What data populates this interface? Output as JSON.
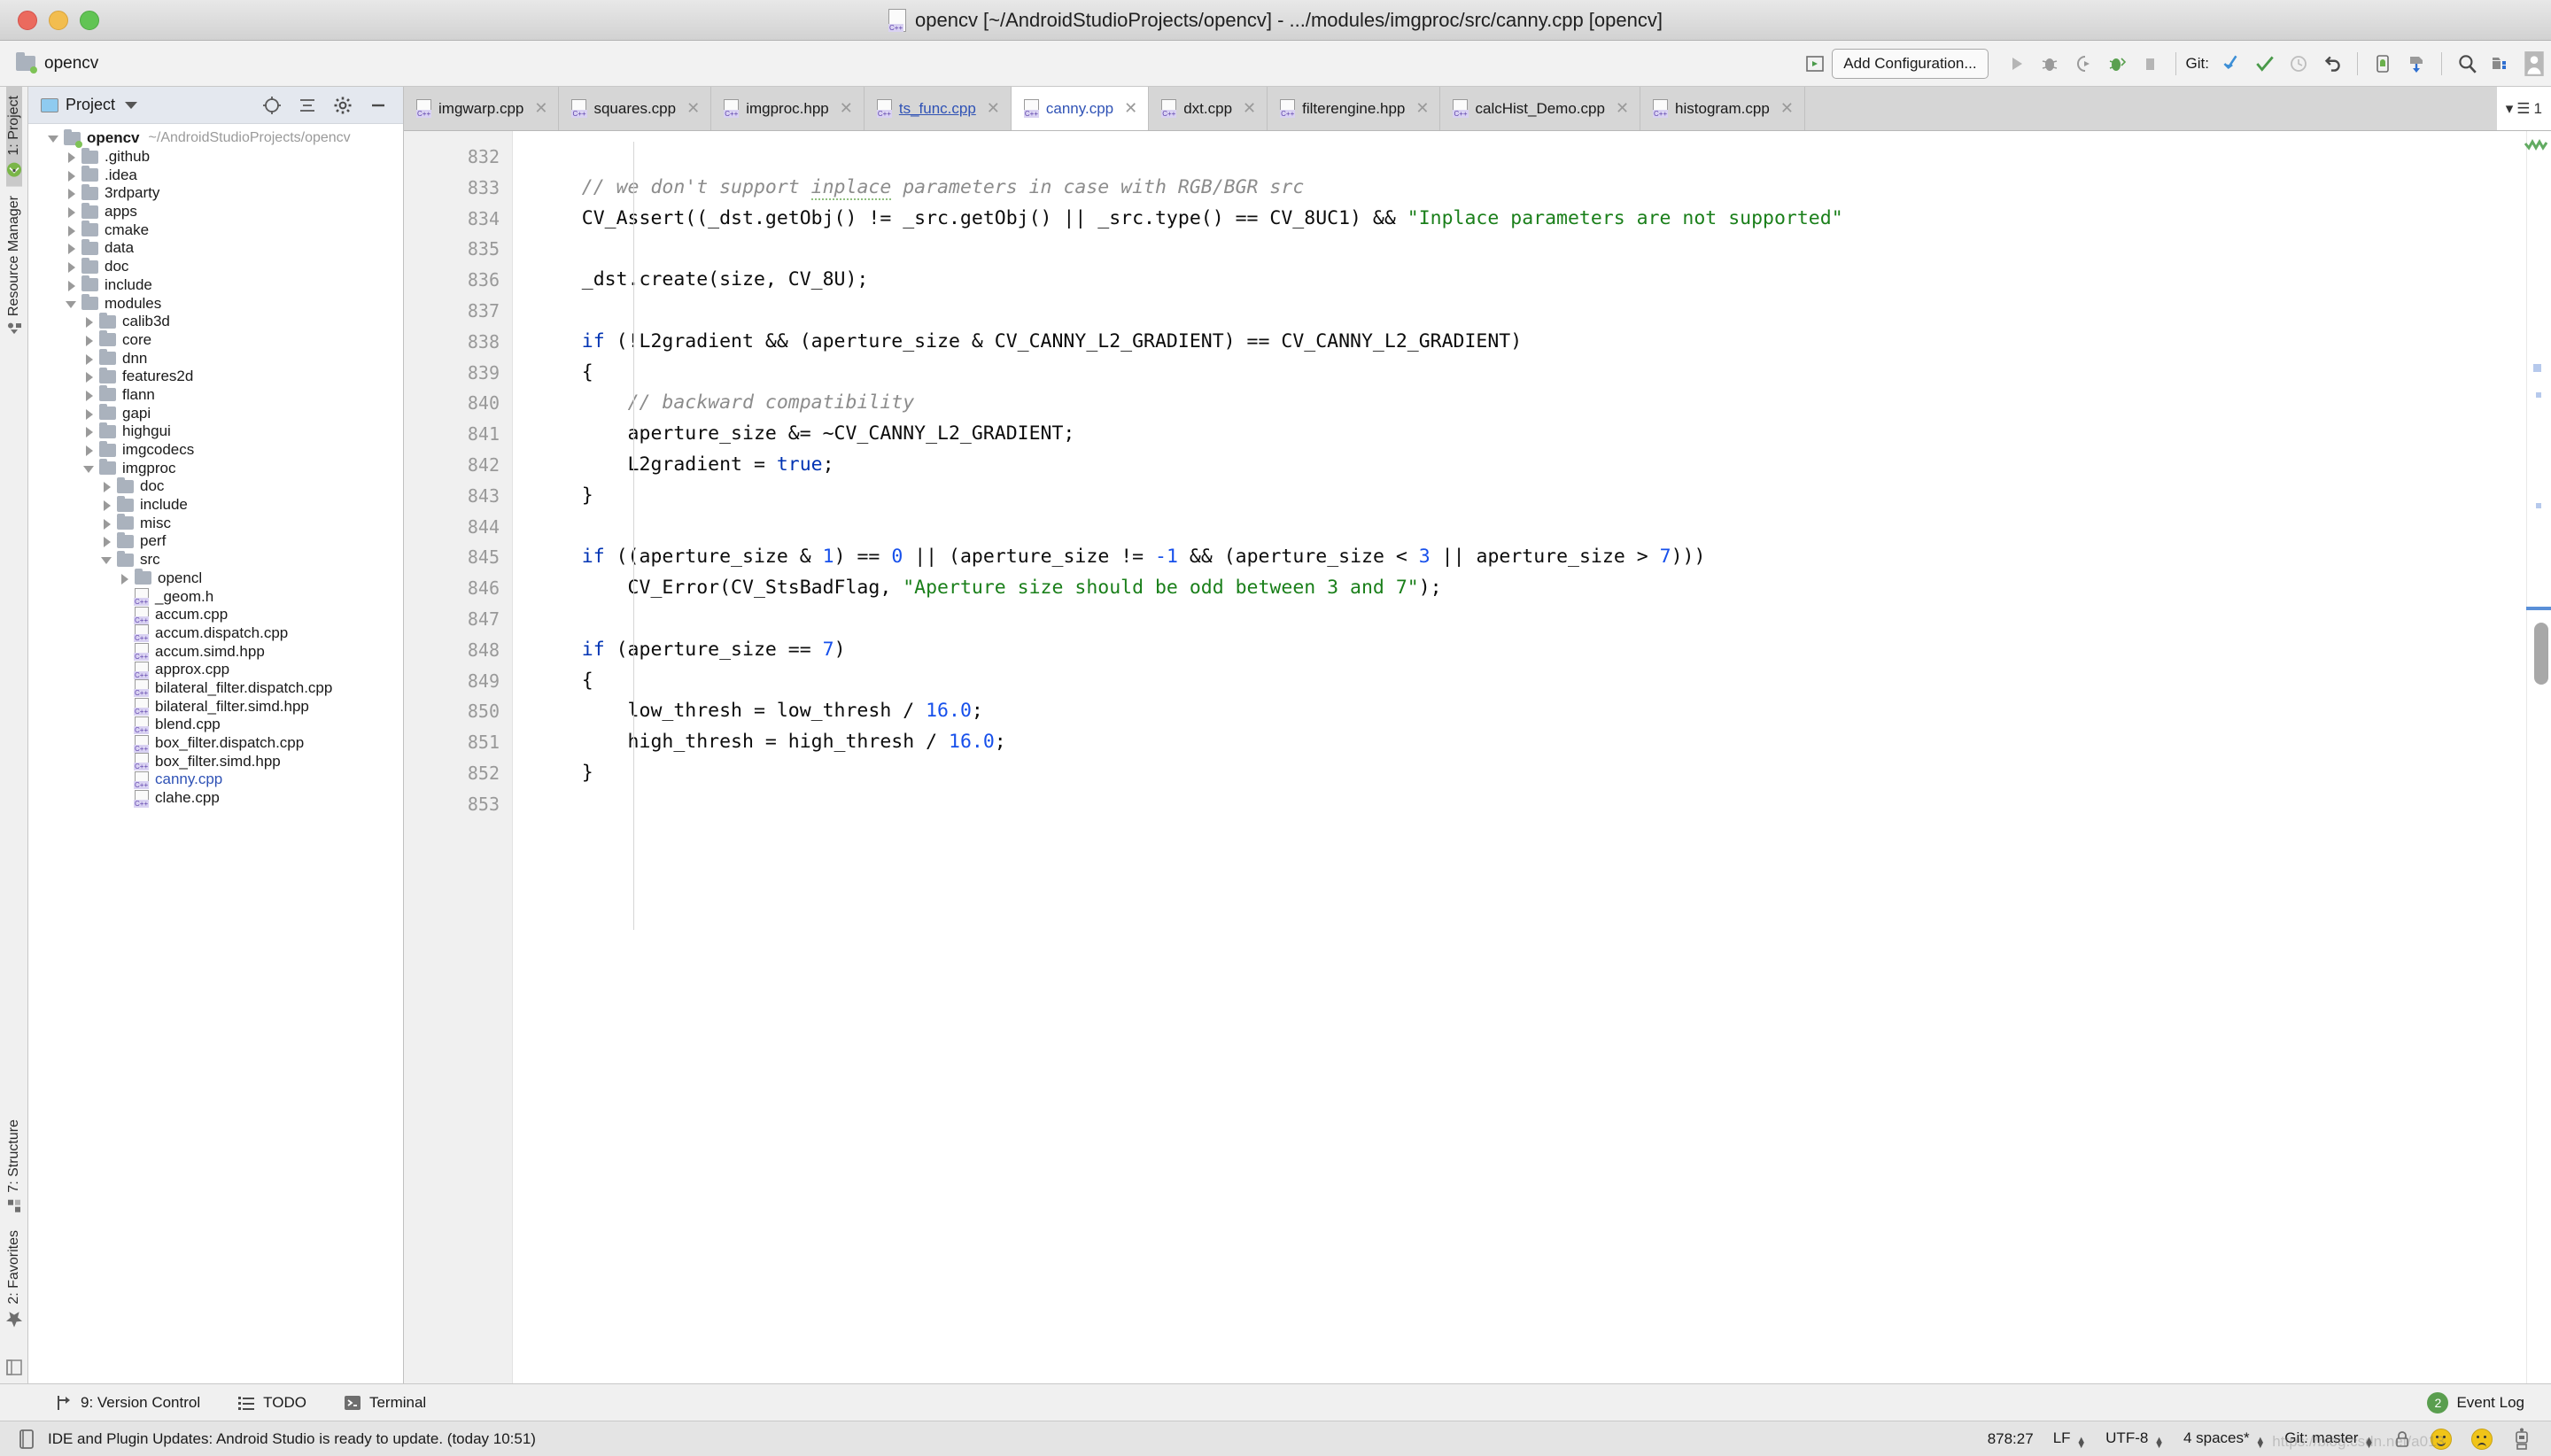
{
  "window": {
    "title": "opencv [~/AndroidStudioProjects/opencv] - .../modules/imgproc/src/canny.cpp [opencv]",
    "file_icon": "cpp-file-icon"
  },
  "toolbar": {
    "project_label": "opencv",
    "add_configuration": "Add Configuration...",
    "git_label": "Git:",
    "icons": [
      "project-structure-icon",
      "run-icon",
      "debug-icon",
      "coverage-icon",
      "profile-icon",
      "stop-icon",
      "update-project-icon",
      "commit-icon",
      "history-icon",
      "revert-icon",
      "avd-manager-icon",
      "sdk-manager-icon",
      "search-everywhere-icon",
      "project-structure-dialog-icon",
      "account-icon"
    ]
  },
  "left_strip": {
    "top": [
      {
        "label": "1: Project",
        "icon": "android-studio-icon",
        "active": true
      },
      {
        "label": "Resource Manager",
        "icon": "shapes-icon",
        "active": false
      }
    ],
    "bottom": [
      {
        "label": "7: Structure",
        "icon": "structure-icon",
        "active": false
      },
      {
        "label": "2: Favorites",
        "icon": "star-icon",
        "active": false
      }
    ]
  },
  "project_panel": {
    "header": {
      "title": "Project",
      "view_icon": "project-view-icon",
      "chevron": "chevron-down-icon",
      "actions": [
        "locate-icon",
        "collapse-all-icon",
        "settings-icon",
        "hide-icon"
      ]
    },
    "tree": [
      {
        "indent": 0,
        "arrow": "open",
        "icon": "folder-modified",
        "name": "opencv",
        "bold": true,
        "path": "~/AndroidStudioProjects/opencv"
      },
      {
        "indent": 1,
        "arrow": "closed",
        "icon": "folder",
        "name": ".github"
      },
      {
        "indent": 1,
        "arrow": "closed",
        "icon": "folder",
        "name": ".idea"
      },
      {
        "indent": 1,
        "arrow": "closed",
        "icon": "folder",
        "name": "3rdparty"
      },
      {
        "indent": 1,
        "arrow": "closed",
        "icon": "folder",
        "name": "apps"
      },
      {
        "indent": 1,
        "arrow": "closed",
        "icon": "folder",
        "name": "cmake"
      },
      {
        "indent": 1,
        "arrow": "closed",
        "icon": "folder",
        "name": "data"
      },
      {
        "indent": 1,
        "arrow": "closed",
        "icon": "folder",
        "name": "doc"
      },
      {
        "indent": 1,
        "arrow": "closed",
        "icon": "folder",
        "name": "include"
      },
      {
        "indent": 1,
        "arrow": "open",
        "icon": "folder",
        "name": "modules"
      },
      {
        "indent": 2,
        "arrow": "closed",
        "icon": "folder",
        "name": "calib3d"
      },
      {
        "indent": 2,
        "arrow": "closed",
        "icon": "folder",
        "name": "core"
      },
      {
        "indent": 2,
        "arrow": "closed",
        "icon": "folder",
        "name": "dnn"
      },
      {
        "indent": 2,
        "arrow": "closed",
        "icon": "folder",
        "name": "features2d"
      },
      {
        "indent": 2,
        "arrow": "closed",
        "icon": "folder",
        "name": "flann"
      },
      {
        "indent": 2,
        "arrow": "closed",
        "icon": "folder",
        "name": "gapi"
      },
      {
        "indent": 2,
        "arrow": "closed",
        "icon": "folder",
        "name": "highgui"
      },
      {
        "indent": 2,
        "arrow": "closed",
        "icon": "folder",
        "name": "imgcodecs"
      },
      {
        "indent": 2,
        "arrow": "open",
        "icon": "folder",
        "name": "imgproc"
      },
      {
        "indent": 3,
        "arrow": "closed",
        "icon": "folder",
        "name": "doc"
      },
      {
        "indent": 3,
        "arrow": "closed",
        "icon": "folder",
        "name": "include"
      },
      {
        "indent": 3,
        "arrow": "closed",
        "icon": "folder",
        "name": "misc"
      },
      {
        "indent": 3,
        "arrow": "closed",
        "icon": "folder",
        "name": "perf"
      },
      {
        "indent": 3,
        "arrow": "open",
        "icon": "folder",
        "name": "src"
      },
      {
        "indent": 4,
        "arrow": "closed",
        "icon": "folder",
        "name": "opencl"
      },
      {
        "indent": 4,
        "arrow": "none",
        "icon": "cpp",
        "name": "_geom.h"
      },
      {
        "indent": 4,
        "arrow": "none",
        "icon": "cpp",
        "name": "accum.cpp"
      },
      {
        "indent": 4,
        "arrow": "none",
        "icon": "cpp",
        "name": "accum.dispatch.cpp"
      },
      {
        "indent": 4,
        "arrow": "none",
        "icon": "cpp",
        "name": "accum.simd.hpp"
      },
      {
        "indent": 4,
        "arrow": "none",
        "icon": "cpp",
        "name": "approx.cpp"
      },
      {
        "indent": 4,
        "arrow": "none",
        "icon": "cpp",
        "name": "bilateral_filter.dispatch.cpp"
      },
      {
        "indent": 4,
        "arrow": "none",
        "icon": "cpp",
        "name": "bilateral_filter.simd.hpp"
      },
      {
        "indent": 4,
        "arrow": "none",
        "icon": "cpp",
        "name": "blend.cpp"
      },
      {
        "indent": 4,
        "arrow": "none",
        "icon": "cpp",
        "name": "box_filter.dispatch.cpp"
      },
      {
        "indent": 4,
        "arrow": "none",
        "icon": "cpp",
        "name": "box_filter.simd.hpp"
      },
      {
        "indent": 4,
        "arrow": "none",
        "icon": "cpp",
        "name": "canny.cpp",
        "selected": true
      },
      {
        "indent": 4,
        "arrow": "none",
        "icon": "cpp",
        "name": "clahe.cpp"
      }
    ]
  },
  "editor": {
    "tabs": [
      {
        "label": "imgwarp.cpp",
        "state": "normal",
        "closable": true
      },
      {
        "label": "squares.cpp",
        "state": "normal",
        "closable": true
      },
      {
        "label": "imgproc.hpp",
        "state": "normal",
        "closable": true
      },
      {
        "label": "ts_func.cpp",
        "state": "modified",
        "closable": true
      },
      {
        "label": "canny.cpp",
        "state": "active",
        "closable": true
      },
      {
        "label": "dxt.cpp",
        "state": "normal",
        "closable": true
      },
      {
        "label": "filterengine.hpp",
        "state": "normal",
        "closable": true
      },
      {
        "label": "calcHist_Demo.cpp",
        "state": "normal",
        "closable": true
      },
      {
        "label": "histogram.cpp",
        "state": "normal",
        "closable": true
      }
    ],
    "tabs_overflow": "1",
    "first_line_number": 832,
    "lines": [
      {
        "n": 832,
        "tokens": []
      },
      {
        "n": 833,
        "tokens": [
          {
            "t": "    ",
            "c": ""
          },
          {
            "t": "// we don't support ",
            "c": "cm"
          },
          {
            "t": "inplace",
            "c": "cm typo"
          },
          {
            "t": " parameters in case with RGB/BGR src",
            "c": "cm"
          }
        ]
      },
      {
        "n": 834,
        "tokens": [
          {
            "t": "    CV_Assert((_dst.getObj() != _src.getObj() || _src.type() == CV_8UC1) && ",
            "c": ""
          },
          {
            "t": "\"Inplace parameters are not supported\"",
            "c": "s"
          }
        ]
      },
      {
        "n": 835,
        "tokens": []
      },
      {
        "n": 836,
        "tokens": [
          {
            "t": "    _dst.create(size, CV_8U);",
            "c": ""
          }
        ]
      },
      {
        "n": 837,
        "tokens": []
      },
      {
        "n": 838,
        "tokens": [
          {
            "t": "    ",
            "c": ""
          },
          {
            "t": "if",
            "c": "k"
          },
          {
            "t": " (!L2gradient && (aperture_size & CV_CANNY_L2_GRADIENT) == CV_CANNY_L2_GRADIENT)",
            "c": ""
          }
        ]
      },
      {
        "n": 839,
        "tokens": [
          {
            "t": "    {",
            "c": ""
          }
        ]
      },
      {
        "n": 840,
        "tokens": [
          {
            "t": "        ",
            "c": ""
          },
          {
            "t": "// backward compatibility",
            "c": "cm"
          }
        ]
      },
      {
        "n": 841,
        "tokens": [
          {
            "t": "        aperture_size &= ~CV_CANNY_L2_GRADIENT;",
            "c": ""
          }
        ]
      },
      {
        "n": 842,
        "tokens": [
          {
            "t": "        L2gradient = ",
            "c": ""
          },
          {
            "t": "true",
            "c": "k"
          },
          {
            "t": ";",
            "c": ""
          }
        ]
      },
      {
        "n": 843,
        "tokens": [
          {
            "t": "    }",
            "c": ""
          }
        ]
      },
      {
        "n": 844,
        "tokens": []
      },
      {
        "n": 845,
        "tokens": [
          {
            "t": "    ",
            "c": ""
          },
          {
            "t": "if",
            "c": "k"
          },
          {
            "t": " ((aperture_size & ",
            "c": ""
          },
          {
            "t": "1",
            "c": "n"
          },
          {
            "t": ") == ",
            "c": ""
          },
          {
            "t": "0",
            "c": "n"
          },
          {
            "t": " || (aperture_size != ",
            "c": ""
          },
          {
            "t": "-1",
            "c": "n"
          },
          {
            "t": " && (aperture_size < ",
            "c": ""
          },
          {
            "t": "3",
            "c": "n"
          },
          {
            "t": " || aperture_size > ",
            "c": ""
          },
          {
            "t": "7",
            "c": "n"
          },
          {
            "t": ")))",
            "c": ""
          }
        ]
      },
      {
        "n": 846,
        "tokens": [
          {
            "t": "        CV_Error(CV_StsBadFlag, ",
            "c": ""
          },
          {
            "t": "\"Aperture size should be odd between 3 and 7\"",
            "c": "s"
          },
          {
            "t": ");",
            "c": ""
          }
        ]
      },
      {
        "n": 847,
        "tokens": []
      },
      {
        "n": 848,
        "tokens": [
          {
            "t": "    ",
            "c": ""
          },
          {
            "t": "if",
            "c": "k"
          },
          {
            "t": " (aperture_size == ",
            "c": ""
          },
          {
            "t": "7",
            "c": "n"
          },
          {
            "t": ")",
            "c": ""
          }
        ]
      },
      {
        "n": 849,
        "tokens": [
          {
            "t": "    {",
            "c": ""
          }
        ]
      },
      {
        "n": 850,
        "tokens": [
          {
            "t": "        low_thresh = low_thresh / ",
            "c": ""
          },
          {
            "t": "16.0",
            "c": "n"
          },
          {
            "t": ";",
            "c": ""
          }
        ]
      },
      {
        "n": 851,
        "tokens": [
          {
            "t": "        high_thresh = high_thresh / ",
            "c": ""
          },
          {
            "t": "16.0",
            "c": "n"
          },
          {
            "t": ";",
            "c": ""
          }
        ]
      },
      {
        "n": 852,
        "tokens": [
          {
            "t": "    }",
            "c": ""
          }
        ]
      },
      {
        "n": 853,
        "tokens": []
      }
    ]
  },
  "bottom_bar": {
    "items": [
      {
        "label": "9: Version Control",
        "icon": "version-control-icon",
        "underline_index": 0
      },
      {
        "label": "TODO",
        "icon": "todo-icon"
      },
      {
        "label": "Terminal",
        "icon": "terminal-icon"
      }
    ],
    "event_log": {
      "label": "Event Log",
      "count": "2"
    }
  },
  "status_bar": {
    "message": "IDE and Plugin Updates: Android Studio is ready to update. (today 10:51)",
    "message_icon": "notification-icon",
    "caret_position": "878:27",
    "line_separator": "LF",
    "encoding": "UTF-8",
    "indent": "4 spaces*",
    "git_branch": "Git: master",
    "lock_icon": "lock-icon",
    "happy_icon": "happy-face-icon",
    "sad_icon": "sad-face-icon",
    "robot_icon": "robot-icon",
    "watermark": "https://blog.csdn.net/a013"
  },
  "colors": {
    "accent_blue": "#2f52b5",
    "keyword": "#0033b3",
    "number": "#1750eb",
    "string": "#1a7f1a",
    "comment": "#8c8c8c",
    "green_ok": "#4a9a4a"
  }
}
